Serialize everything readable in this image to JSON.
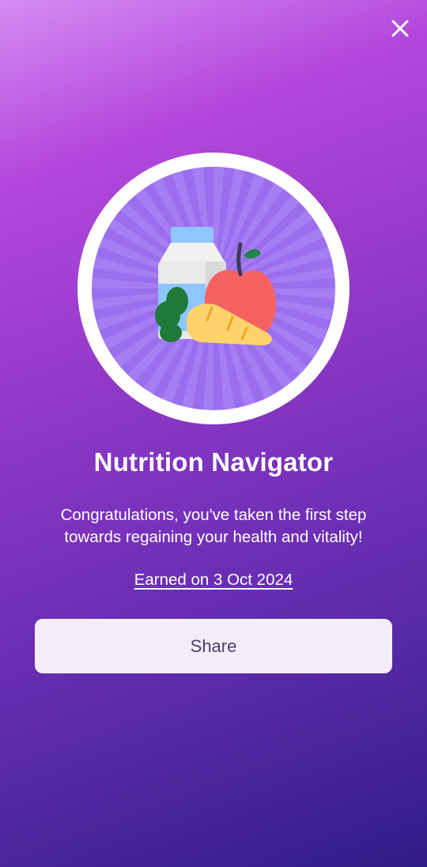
{
  "badge": {
    "title": "Nutrition Navigator",
    "message": "Congratulations, you've taken the first step towards regaining your health and vitality!",
    "earned_text": "Earned on 3 Oct 2024",
    "illustration_icons": [
      "milk-carton-icon",
      "apple-icon",
      "carrot-icon"
    ]
  },
  "actions": {
    "share_label": "Share",
    "close_icon": "close-icon"
  },
  "colors": {
    "background_top": "#d58cf2",
    "background_bottom": "#2f1c87",
    "badge_circle": "#9d72f0",
    "share_button_bg": "#f5eef8",
    "share_button_text": "#4a3d6e"
  }
}
